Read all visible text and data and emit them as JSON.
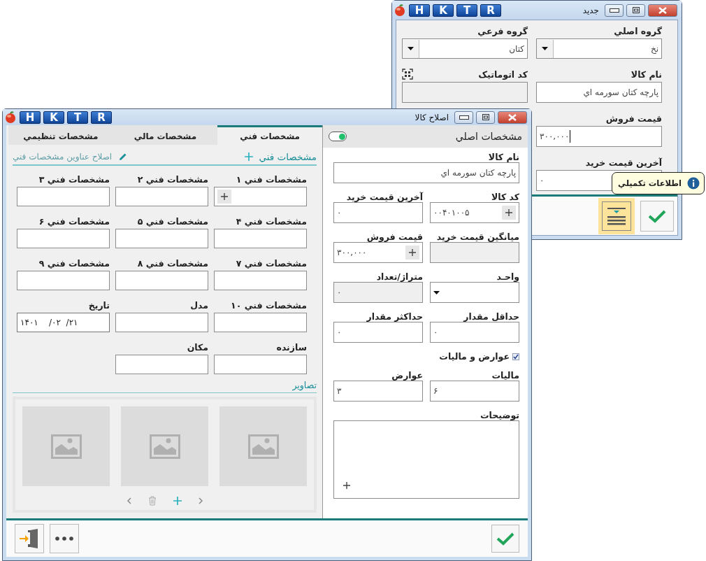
{
  "back_window": {
    "title": "جديد",
    "title_buttons": [
      "R",
      "T",
      "K",
      "H"
    ],
    "rows": [
      [
        {
          "kind": "combo",
          "label": "گروه اصلي",
          "value": "نخ"
        },
        {
          "kind": "combo",
          "label": "گروه فرعي",
          "value": "کتان"
        }
      ],
      [
        {
          "kind": "text",
          "label": "نام کالا",
          "value": "پارچه کتان سورمه اي",
          "focused": false
        },
        {
          "kind": "auto",
          "label": "کد اتوماتیک"
        }
      ],
      [
        {
          "kind": "text",
          "label": "قيمت فروش",
          "value": "۳۰۰,۰۰۰",
          "focused": true
        }
      ],
      [
        {
          "kind": "text",
          "label": "آخرين قيمت خريد",
          "value": "۰",
          "focused": false
        }
      ]
    ],
    "menu_button": {
      "highlighted": true
    },
    "tooltip": "اطلاعات تکميلي"
  },
  "edit_window": {
    "title": "اصلاح کالا",
    "title_buttons": [
      "R",
      "T",
      "K",
      "H"
    ],
    "main_panel": {
      "title": "مشخصات اصلي",
      "toggle_on": true,
      "fields": [
        {
          "kind": "wide",
          "label": "نام کالا",
          "value": "پارچه کتان سورمه اي"
        },
        {
          "kind": "plus",
          "label": "کد کالا",
          "value": "۰۰۴۰۱۰۰۵"
        },
        {
          "kind": "text",
          "label": "آخرين قيمت خريد",
          "value": "۰"
        },
        {
          "kind": "disabled",
          "label": "ميانگين قيمت خريد"
        },
        {
          "kind": "plus",
          "label": "قيمت فروش",
          "value": "۳۰۰,۰۰۰"
        },
        {
          "kind": "combo",
          "label": "واحـد"
        },
        {
          "kind": "disabled",
          "label": "متراژ/تعداد",
          "value": "۰"
        },
        {
          "kind": "text",
          "label": "حداقل مقدار",
          "value": "۰"
        },
        {
          "kind": "text",
          "label": "حداکثر مقدار",
          "value": "۰"
        },
        {
          "kind": "checkbox",
          "label": "عوارض و ماليات",
          "checked": true
        },
        {
          "kind": "text",
          "label": "ماليات",
          "value": "۶"
        },
        {
          "kind": "text",
          "label": "عوارض",
          "value": "۳"
        },
        {
          "kind": "memo",
          "label": "توضيحات"
        }
      ]
    },
    "tabs": [
      {
        "label": "مشخصات فني",
        "selected": true
      },
      {
        "label": "مشخصات مالي",
        "selected": false
      },
      {
        "label": "مشخصات تنظيمي",
        "selected": false
      }
    ],
    "tech": {
      "title": "مشخصات فني",
      "edit_link": "اصلاح عناوين مشخصات فني",
      "fields": [
        {
          "kind": "plus",
          "label": "مشخصات فني ۱"
        },
        {
          "kind": "text",
          "label": "مشخصات فني ۲"
        },
        {
          "kind": "text",
          "label": "مشخصات فني ۳"
        },
        {
          "kind": "text",
          "label": "مشخصات فني ۴"
        },
        {
          "kind": "text",
          "label": "مشخصات فني ۵"
        },
        {
          "kind": "text",
          "label": "مشخصات فني ۶"
        },
        {
          "kind": "text",
          "label": "مشخصات فني ۷"
        },
        {
          "kind": "text",
          "label": "مشخصات فني ۸"
        },
        {
          "kind": "text",
          "label": "مشخصات فني ۹"
        },
        {
          "kind": "text",
          "label": "مشخصات فني ۱۰"
        },
        {
          "kind": "text",
          "label": "مدل"
        },
        {
          "kind": "date",
          "label": "تاريخ",
          "value": "۱۴۰۱    /۰۲  /۲۱"
        },
        {
          "kind": "text",
          "label": "سازنده"
        },
        {
          "kind": "text",
          "label": "مکان"
        }
      ]
    },
    "images": {
      "title": "تصاوير",
      "slots": [
        {
          "kind": "placeholder"
        },
        {
          "kind": "placeholder"
        },
        {
          "kind": "placeholder"
        }
      ]
    }
  }
}
